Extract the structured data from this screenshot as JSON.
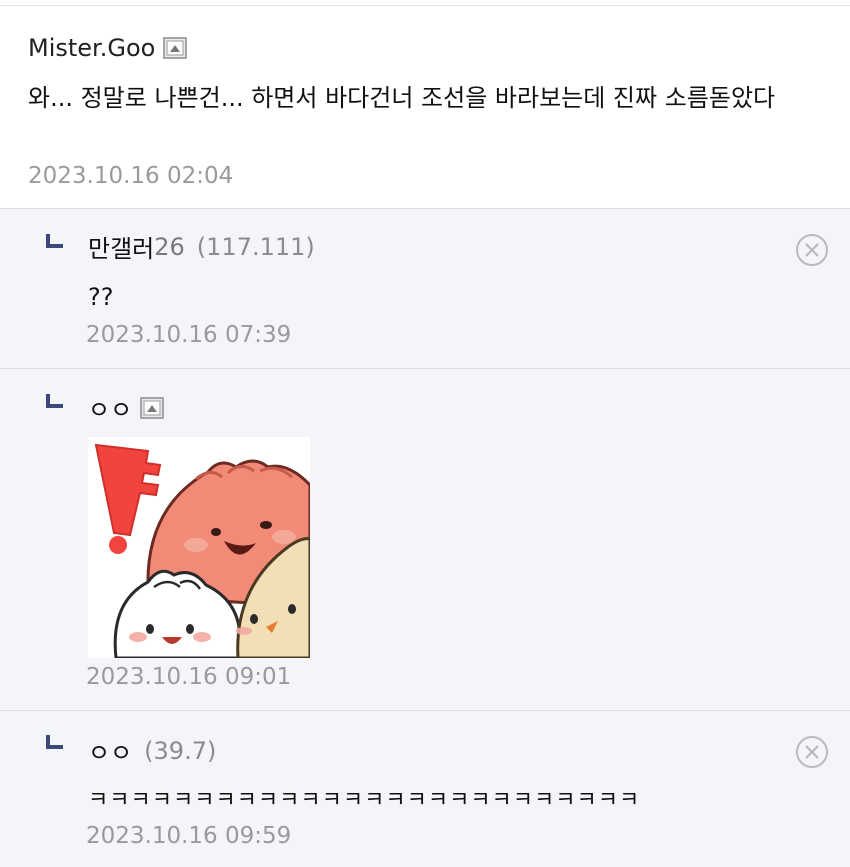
{
  "main": {
    "author": "Mister.Goo",
    "text": "와... 정말로 나쁜건... 하면서 바다건너 조선을 바라보는데 진짜 소름돋았다",
    "date": "2023.10.16 02:04"
  },
  "replies": [
    {
      "author": "만갤러",
      "number": "26",
      "ip": "(117.111)",
      "text": "??",
      "date": "2023.10.16 07:39"
    },
    {
      "author": "ㅇㅇ",
      "text": "",
      "date": "2023.10.16 09:01"
    },
    {
      "author": "ㅇㅇ",
      "ip": "(39.7)",
      "text": "ㅋㅋㅋㅋㅋㅋㅋㅋㅋㅋㅋㅋㅋㅋㅋㅋㅋㅋㅋㅋㅋㅋㅋㅋㅋㅋ",
      "date": "2023.10.16 09:59"
    }
  ],
  "colors": {
    "reply_bg": "#f4f5f9",
    "date": "#9a9a9a",
    "arrow": "#3b4a7a"
  },
  "icons": {
    "badge": "fixed-nick-icon",
    "reply": "reply-arrow-icon",
    "delete": "delete-circle-x-icon"
  }
}
